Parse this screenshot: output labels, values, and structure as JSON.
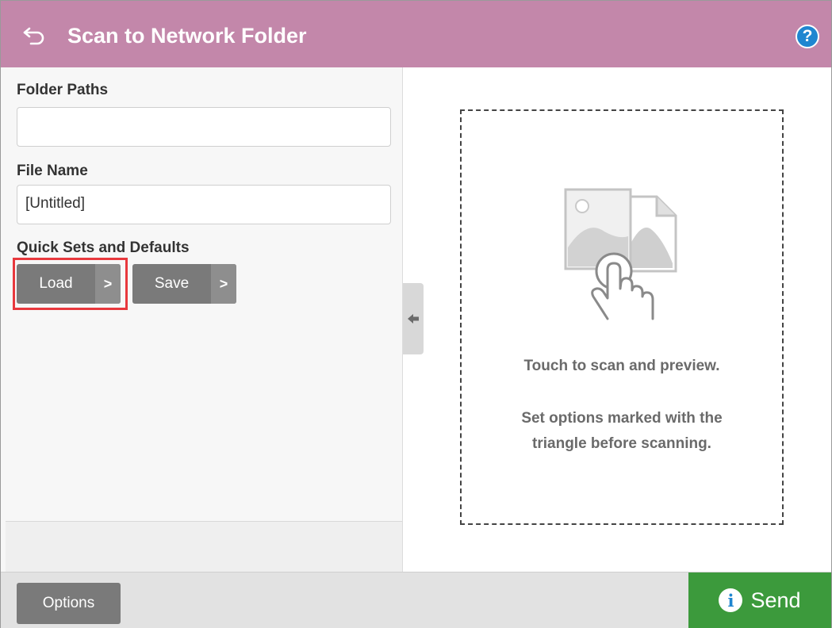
{
  "header": {
    "title": "Scan to Network Folder",
    "back_icon": "back-arrow-icon",
    "help_label": "?"
  },
  "form": {
    "folder_paths": {
      "label": "Folder Paths",
      "value": ""
    },
    "file_name": {
      "label": "File Name",
      "value": "[Untitled]"
    },
    "quick_sets": {
      "label": "Quick Sets and Defaults",
      "load_label": "Load",
      "save_label": "Save",
      "arrow": ">"
    }
  },
  "preview": {
    "line1": "Touch to scan and preview.",
    "line2": "Set options marked with the",
    "line3": "triangle before scanning."
  },
  "footer": {
    "options_label": "Options",
    "send_label": "Send",
    "send_icon": "info-icon"
  },
  "colors": {
    "header": "#c387aa",
    "send": "#3c9a3c",
    "help": "#1f86d0",
    "highlight": "#e8383d",
    "button": "#7a7a7a"
  }
}
